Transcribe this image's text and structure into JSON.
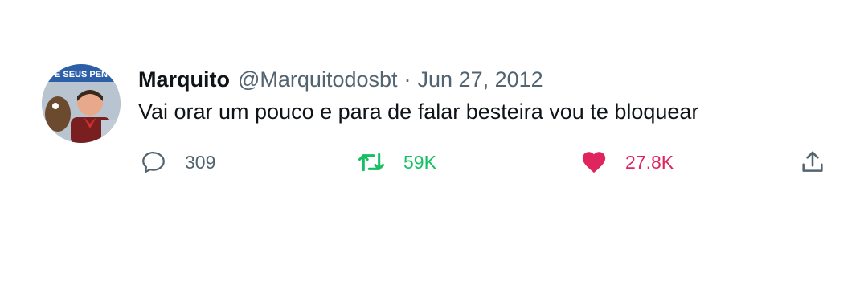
{
  "user": {
    "display_name": "Marquito",
    "handle": "@Marquitodosbt",
    "separator": "·",
    "date": "Jun 27, 2012",
    "avatar_banner_text": "E SEUS PEN"
  },
  "tweet": {
    "text": "Vai orar um pouco e para de falar besteira vou te bloquear"
  },
  "actions": {
    "reply_count": "309",
    "retweet_count": "59K",
    "like_count": "27.8K"
  },
  "icons": {
    "reply": "reply-icon",
    "retweet": "retweet-icon",
    "like": "heart-icon",
    "share": "share-icon"
  },
  "colors": {
    "retweet_active": "#17bf63",
    "like_active": "#e0245e",
    "secondary_text": "#536471",
    "primary_text": "#0f1419"
  }
}
